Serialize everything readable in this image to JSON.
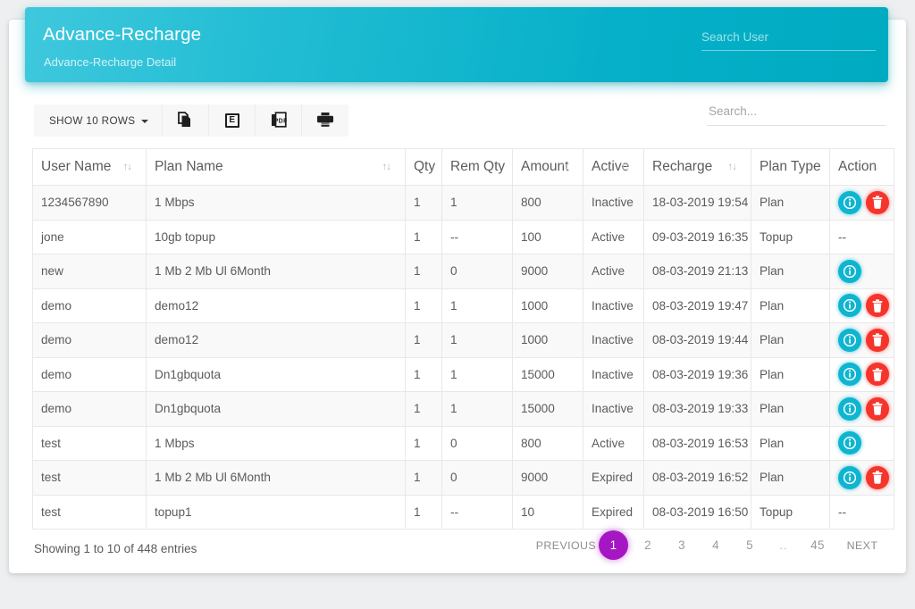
{
  "header": {
    "title": "Advance-Recharge",
    "subtitle": "Advance-Recharge Detail",
    "search_placeholder": "Search User",
    "search_value": "",
    "gradient_from": "#3fc8dd",
    "gradient_to": "#00abc2"
  },
  "toolbar": {
    "rows_label": "SHOW 10 ROWS",
    "buttons": [
      {
        "name": "copy",
        "label": ""
      },
      {
        "name": "excel",
        "label": "E"
      },
      {
        "name": "pdf",
        "label": "PDF"
      },
      {
        "name": "print",
        "label": ""
      }
    ]
  },
  "table_search": {
    "placeholder": "Search...",
    "value": ""
  },
  "table": {
    "columns": [
      {
        "label": "User Name",
        "sortable": true,
        "sort_visible": "strong"
      },
      {
        "label": "Plan Name",
        "sortable": true,
        "sort_visible": "strong"
      },
      {
        "label": "Qty",
        "sortable": false,
        "sort_visible": "none"
      },
      {
        "label": "Rem Qty",
        "sortable": false,
        "sort_visible": "none"
      },
      {
        "label": "Amount",
        "sortable": true,
        "sort_visible": "dim"
      },
      {
        "label": "Active",
        "sortable": true,
        "sort_visible": "dim"
      },
      {
        "label": "Recharge",
        "sortable": true,
        "sort_visible": "strong"
      },
      {
        "label": "Plan Type",
        "sortable": true,
        "sort_visible": "dim"
      },
      {
        "label": "Action",
        "sortable": true,
        "sort_visible": "dim"
      }
    ],
    "sort_glyph": "↑↓",
    "rows": [
      {
        "user_name": "1234567890",
        "plan_name": "1 Mbps",
        "qty": "1",
        "rem_qty": "1",
        "amount": "800",
        "active": "Inactive",
        "recharge": "18-03-2019 19:54",
        "plan_type": "Plan",
        "actions": [
          "info",
          "delete"
        ]
      },
      {
        "user_name": "jone",
        "plan_name": "10gb topup",
        "qty": "1",
        "rem_qty": "--",
        "amount": "100",
        "active": "Active",
        "recharge": "09-03-2019 16:35",
        "plan_type": "Topup",
        "actions": [
          "dash"
        ]
      },
      {
        "user_name": "new",
        "plan_name": "1 Mb 2 Mb Ul 6Month",
        "qty": "1",
        "rem_qty": "0",
        "amount": "9000",
        "active": "Active",
        "recharge": "08-03-2019 21:13",
        "plan_type": "Plan",
        "actions": [
          "info"
        ]
      },
      {
        "user_name": "demo",
        "plan_name": "demo12",
        "qty": "1",
        "rem_qty": "1",
        "amount": "1000",
        "active": "Inactive",
        "recharge": "08-03-2019 19:47",
        "plan_type": "Plan",
        "actions": [
          "info",
          "delete"
        ]
      },
      {
        "user_name": "demo",
        "plan_name": "demo12",
        "qty": "1",
        "rem_qty": "1",
        "amount": "1000",
        "active": "Inactive",
        "recharge": "08-03-2019 19:44",
        "plan_type": "Plan",
        "actions": [
          "info",
          "delete"
        ]
      },
      {
        "user_name": "demo",
        "plan_name": "Dn1gbquota",
        "qty": "1",
        "rem_qty": "1",
        "amount": "15000",
        "active": "Inactive",
        "recharge": "08-03-2019 19:36",
        "plan_type": "Plan",
        "actions": [
          "info",
          "delete"
        ]
      },
      {
        "user_name": "demo",
        "plan_name": "Dn1gbquota",
        "qty": "1",
        "rem_qty": "1",
        "amount": "15000",
        "active": "Inactive",
        "recharge": "08-03-2019 19:33",
        "plan_type": "Plan",
        "actions": [
          "info",
          "delete"
        ]
      },
      {
        "user_name": "test",
        "plan_name": "1 Mbps",
        "qty": "1",
        "rem_qty": "0",
        "amount": "800",
        "active": "Active",
        "recharge": "08-03-2019 16:53",
        "plan_type": "Plan",
        "actions": [
          "info"
        ]
      },
      {
        "user_name": "test",
        "plan_name": "1 Mb 2 Mb Ul 6Month",
        "qty": "1",
        "rem_qty": "0",
        "amount": "9000",
        "active": "Expired",
        "recharge": "08-03-2019 16:52",
        "plan_type": "Plan",
        "actions": [
          "info",
          "delete"
        ]
      },
      {
        "user_name": "test",
        "plan_name": "topup1",
        "qty": "1",
        "rem_qty": "--",
        "amount": "10",
        "active": "Expired",
        "recharge": "08-03-2019 16:50",
        "plan_type": "Topup",
        "actions": [
          "dash"
        ]
      }
    ]
  },
  "footer": {
    "info": "Showing 1 to 10 of 448 entries",
    "previous_label": "PREVIOUS",
    "next_label": "NEXT",
    "pages": [
      "1",
      "2",
      "3",
      "4",
      "5",
      "..",
      "45"
    ],
    "active_page": "1",
    "active_color": "#a617c4"
  }
}
